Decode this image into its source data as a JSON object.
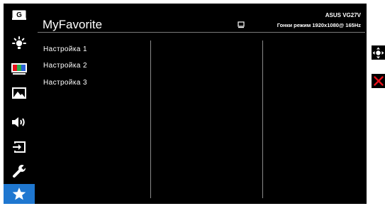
{
  "header": {
    "title": "MyFavorite",
    "model": "ASUS  VG27V",
    "mode_info": "Гонки режим 1920x1080@ 165Hz"
  },
  "sidebar": {
    "items": [
      {
        "icon": "gameplus-icon",
        "label": "G"
      },
      {
        "icon": "brightness-icon"
      },
      {
        "icon": "color-icon"
      },
      {
        "icon": "image-icon"
      },
      {
        "icon": "sound-icon"
      },
      {
        "icon": "input-select-icon"
      },
      {
        "icon": "system-setup-icon"
      },
      {
        "icon": "star-icon",
        "active": true
      }
    ]
  },
  "menu": {
    "items": [
      "Настройка 1",
      "Настройка 2",
      "Настройка 3"
    ]
  },
  "colors": {
    "background": "#000000",
    "active": "#1f77d0",
    "close": "#e8111b",
    "text": "#ffffff",
    "divider": "#8a8a8a"
  },
  "controls": {
    "navigate": "joystick-icon",
    "exit": "close-icon"
  }
}
